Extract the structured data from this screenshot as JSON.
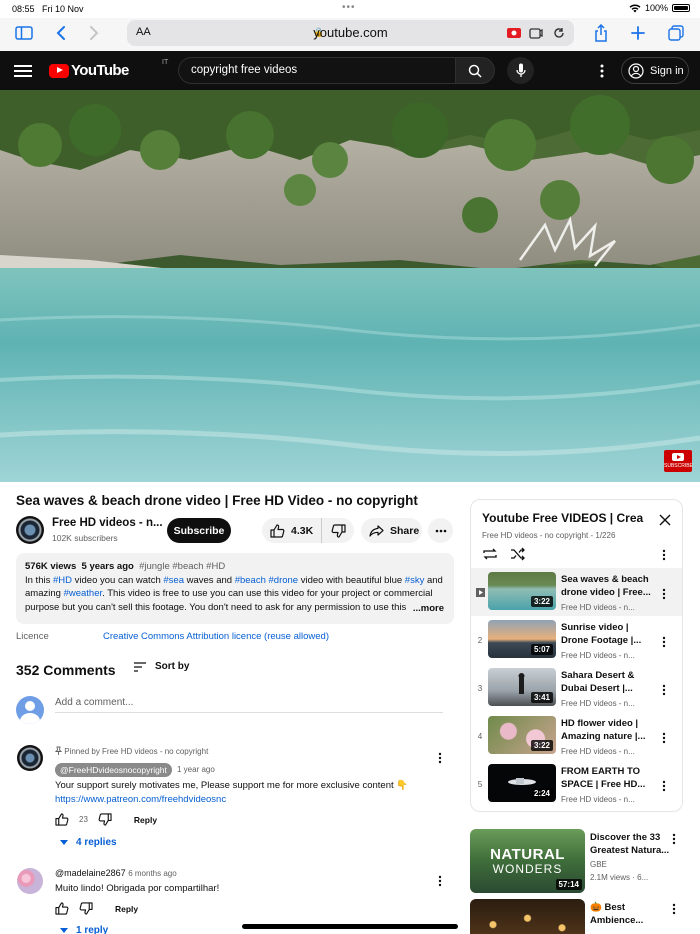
{
  "status": {
    "time": "08:55",
    "date": "Fri 10 Nov",
    "battery": "100%"
  },
  "browser": {
    "aa": "AA",
    "url": "youtube.com"
  },
  "header": {
    "logo": "YouTube",
    "country": "IT",
    "search_value": "copyright free videos",
    "signin_label": "Sign in"
  },
  "video": {
    "title": "Sea waves & beach drone video | Free HD Video - no copyright",
    "channel": "Free HD videos - n...",
    "subscribers": "102K subscribers",
    "subscribe_label": "Subscribe",
    "likes": "4.3K",
    "share_label": "Share",
    "watermark": "SUBSCRIBE"
  },
  "description": {
    "views": "576K views",
    "age": "5 years ago",
    "tags_top": "#jungle #beach #HD",
    "t1": "In this ",
    "h1": "#HD",
    "t2": " video you can watch ",
    "h2": "#sea",
    "t3": " waves and ",
    "h3": "#beach",
    "t4": " ",
    "h4": "#drone",
    "t5": " video with beautiful blue ",
    "h5": "#sky",
    "t6": " and amazing ",
    "h6": "#weather",
    "t7": ". This video is free to use you can use this video for your project or commercial purpose but you can't sell this footage. You don't need to ask for any permission to use this",
    "more": "...more"
  },
  "licence": {
    "label": "Licence",
    "value": "Creative Commons Attribution licence (reuse allowed)"
  },
  "comments": {
    "count": "352 Comments",
    "sort_label": "Sort by",
    "add_placeholder": "Add a comment...",
    "items": [
      {
        "pinned": "Pinned by Free HD videos - no copyright",
        "author": "@FreeHDvideosnocopyright",
        "time": "1 year ago",
        "text": "Your support surely motivates me, Please support me for more exclusive content 👇",
        "link": "https://www.patreon.com/freehdvideosnc",
        "likes": "23",
        "reply_label": "Reply",
        "replies": "4 replies"
      },
      {
        "author": "@madelaine2867",
        "time": "6 months ago",
        "text": "Muito lindo! Obrigada por compartilhar!",
        "likes": "",
        "reply_label": "Reply",
        "replies": "1 reply"
      }
    ]
  },
  "playlist": {
    "title": "Youtube Free VIDEOS | Crea",
    "subtitle": "Free HD videos - no copyright - 1/226",
    "items": [
      {
        "index": "",
        "title": "Sea waves & beach drone video | Free...",
        "channel": "Free HD videos - n...",
        "duration": "3:22",
        "thumb": "sea"
      },
      {
        "index": "2",
        "title": "Sunrise video | Drone Footage |...",
        "channel": "Free HD videos - n...",
        "duration": "5:07",
        "thumb": "sunrise"
      },
      {
        "index": "3",
        "title": "Sahara Desert & Dubai Desert |...",
        "channel": "Free HD videos - n...",
        "duration": "3:41",
        "thumb": "desert"
      },
      {
        "index": "4",
        "title": "HD flower video | Amazing nature |...",
        "channel": "Free HD videos - n...",
        "duration": "3:22",
        "thumb": "flower"
      },
      {
        "index": "5",
        "title": "FROM EARTH TO SPACE | Free HD...",
        "channel": "Free HD videos - n...",
        "duration": "2:24",
        "thumb": "space"
      }
    ]
  },
  "recommended": [
    {
      "title": "Discover the 33 Greatest Natura...",
      "channel": "GBE",
      "views": "2.1M views · 6...",
      "duration": "57:14",
      "overlay1": "NATURAL",
      "overlay2": "WONDERS"
    },
    {
      "title": "🎃 Best Ambience...",
      "channel": "",
      "views": "",
      "duration": ""
    }
  ],
  "colors": {
    "accent_red": "#ff0000",
    "link_blue": "#065fd4",
    "header_bg": "#0f0f0f"
  }
}
